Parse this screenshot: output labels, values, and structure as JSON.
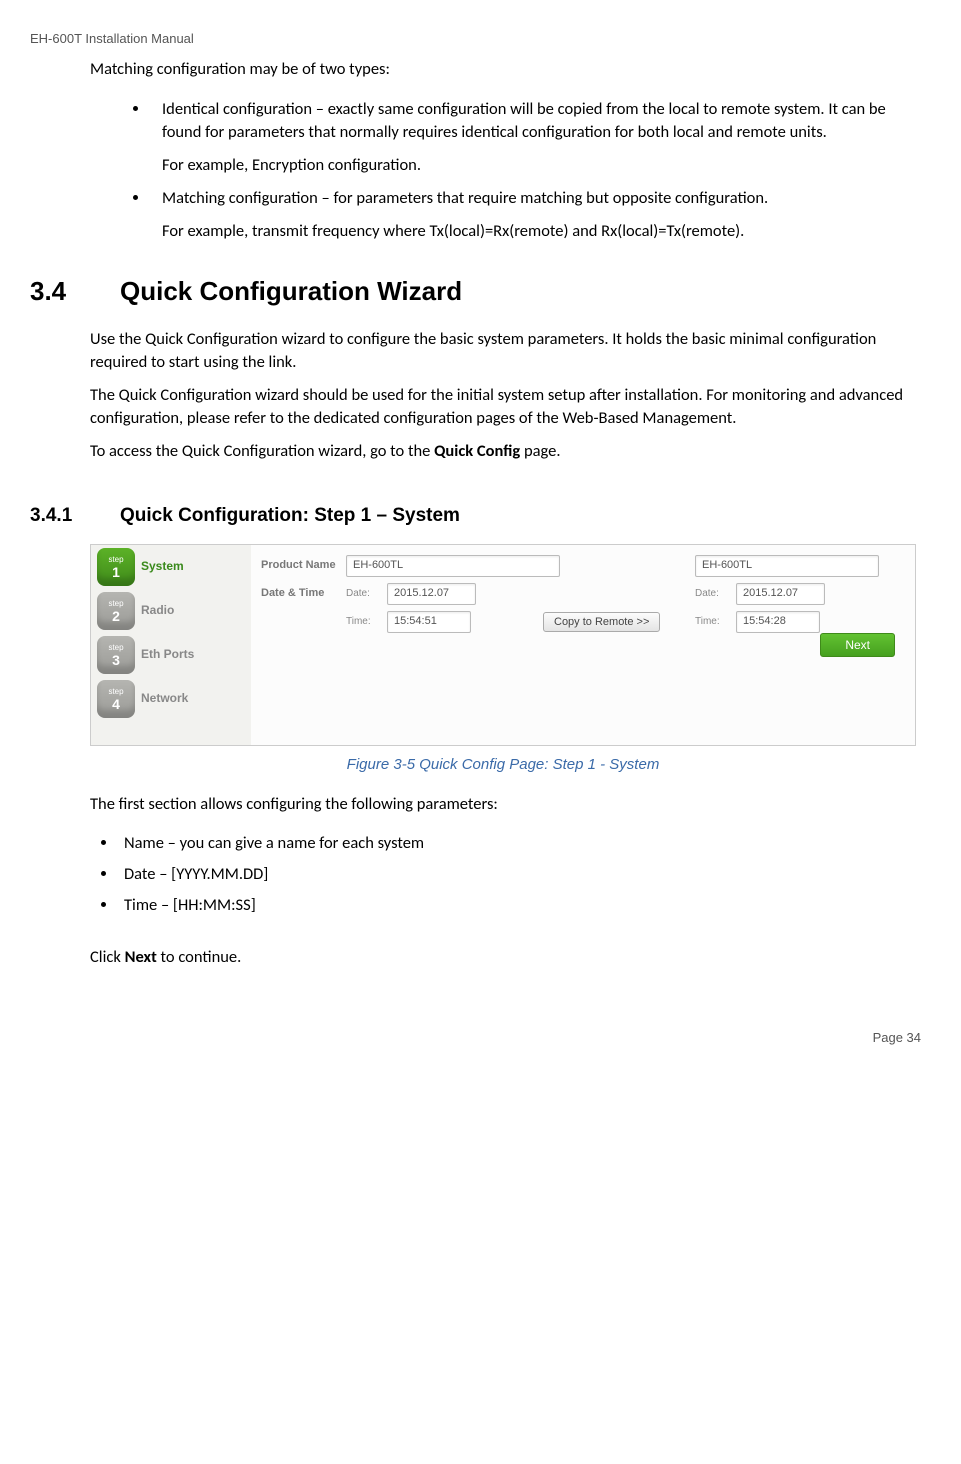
{
  "header": "EH-600T Installation Manual",
  "intro_line": "Matching configuration may be of two types:",
  "bullets": [
    {
      "main": "Identical configuration – exactly same configuration will be copied from the local to remote system. It can be found for parameters that normally requires identical configuration for both local and remote units.",
      "sub": "For example, Encryption configuration."
    },
    {
      "main": " Matching configuration – for parameters that require matching but opposite configuration.",
      "sub": "For example, transmit frequency where Tx(local)=Rx(remote) and Rx(local)=Tx(remote)."
    }
  ],
  "section": {
    "num": "3.4",
    "title": "Quick Configuration Wizard",
    "p1": "Use the Quick Configuration wizard to configure the basic system parameters. It holds the basic minimal configuration required to start using the link.",
    "p2": "The Quick Configuration wizard should be used for the initial system setup after installation. For monitoring and advanced configuration, please refer to the dedicated configuration pages of the Web-Based Management.",
    "p3_a": "To access the Quick Configuration wizard, go to the ",
    "p3_bold": "Quick Config",
    "p3_b": " page."
  },
  "subsection": {
    "num": "3.4.1",
    "title": "Quick Configuration: Step 1 – System"
  },
  "screenshot": {
    "steps": [
      {
        "num": "1",
        "label": "System",
        "active": true
      },
      {
        "num": "2",
        "label": "Radio",
        "active": false
      },
      {
        "num": "3",
        "label": "Eth Ports",
        "active": false
      },
      {
        "num": "4",
        "label": "Network",
        "active": false
      }
    ],
    "labels": {
      "product_name": "Product Name",
      "date_time": "Date & Time",
      "date": "Date:",
      "time": "Time:"
    },
    "local": {
      "product": "EH-600TL",
      "date": "2015.12.07",
      "time": "15:54:51"
    },
    "remote": {
      "product": "EH-600TL",
      "date": "2015.12.07",
      "time": "15:54:28"
    },
    "copy_btn": "Copy to Remote >>",
    "next_btn": "Next"
  },
  "figure_caption": "Figure 3-5 Quick Config Page: Step 1 - System",
  "after_fig": "The first section allows configuring the following parameters:",
  "params": [
    "Name – you can give a name for each system",
    "Date – [YYYY.MM.DD]",
    "Time – [HH:MM:SS]"
  ],
  "click_next_a": "Click ",
  "click_next_bold": "Next",
  "click_next_b": " to continue.",
  "footer": "Page 34"
}
